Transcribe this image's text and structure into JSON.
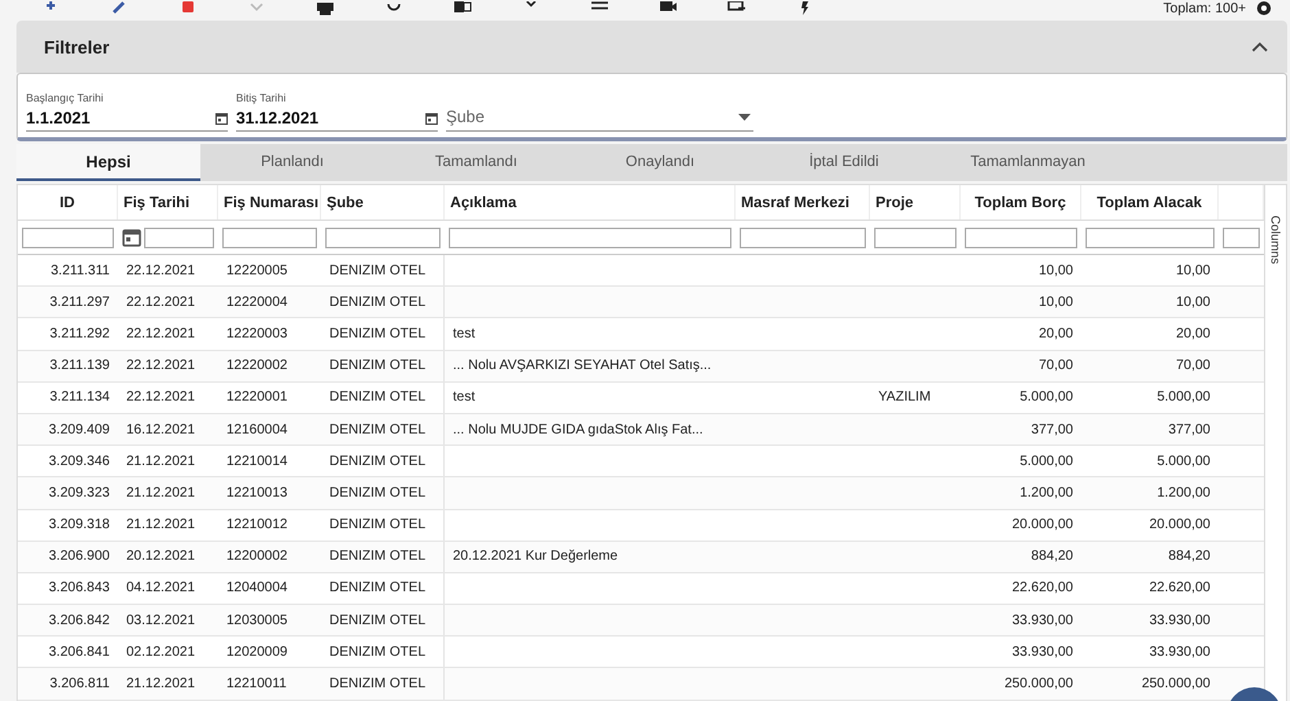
{
  "toolbar": {
    "total": "Toplam: 100+"
  },
  "filters": {
    "title": "Filtreler",
    "expanded": true,
    "start_date": {
      "label": "Başlangıç Tarihi",
      "value": "1.1.2021"
    },
    "end_date": {
      "label": "Bitiş Tarihi",
      "value": "31.12.2021"
    },
    "branch": {
      "placeholder": "Şube"
    }
  },
  "tabs": [
    {
      "label": "Hepsi",
      "selected": true
    },
    {
      "label": "Planlandı",
      "selected": false
    },
    {
      "label": "Tamamlandı",
      "selected": false
    },
    {
      "label": "Onaylandı",
      "selected": false
    },
    {
      "label": "İptal Edildi",
      "selected": false
    },
    {
      "label": "Tamamlanmayan",
      "selected": false
    }
  ],
  "table": {
    "columns": [
      {
        "label": "ID",
        "kind": "number"
      },
      {
        "label": "Fiş Tarihi",
        "kind": "date"
      },
      {
        "label": "Fiş Numarası",
        "kind": "text"
      },
      {
        "label": "Şube",
        "kind": "text"
      },
      {
        "label": "Açıklama",
        "kind": "text"
      },
      {
        "label": "Masraf Merkezi",
        "kind": "text"
      },
      {
        "label": "Proje",
        "kind": "text"
      },
      {
        "label": "Toplam Borç",
        "kind": "number"
      },
      {
        "label": "Toplam Alacak",
        "kind": "number"
      },
      {
        "kind": "text"
      }
    ],
    "rows": [
      [
        "3.211.311",
        "22.12.2021",
        "12220005",
        "DENIZIM OTEL",
        "",
        "",
        "",
        "10,00",
        "10,00"
      ],
      [
        "3.211.297",
        "22.12.2021",
        "12220004",
        "DENIZIM OTEL",
        "",
        "",
        "",
        "10,00",
        "10,00"
      ],
      [
        "3.211.292",
        "22.12.2021",
        "12220003",
        "DENIZIM OTEL",
        "test",
        "",
        "",
        "20,00",
        "20,00"
      ],
      [
        "3.211.139",
        "22.12.2021",
        "12220002",
        "DENIZIM OTEL",
        "... Nolu AVŞARKIZI SEYAHAT Otel Satış...",
        "",
        "",
        "70,00",
        "70,00"
      ],
      [
        "3.211.134",
        "22.12.2021",
        "12220001",
        "DENIZIM OTEL",
        "test",
        "",
        "YAZILIM",
        "5.000,00",
        "5.000,00"
      ],
      [
        "3.209.409",
        "16.12.2021",
        "12160004",
        "DENIZIM OTEL",
        "... Nolu MUJDE GIDA gıdaStok Alış Fat...",
        "",
        "",
        "377,00",
        "377,00"
      ],
      [
        "3.209.346",
        "21.12.2021",
        "12210014",
        "DENIZIM OTEL",
        "",
        "",
        "",
        "5.000,00",
        "5.000,00"
      ],
      [
        "3.209.323",
        "21.12.2021",
        "12210013",
        "DENIZIM OTEL",
        "",
        "",
        "",
        "1.200,00",
        "1.200,00"
      ],
      [
        "3.209.318",
        "21.12.2021",
        "12210012",
        "DENIZIM OTEL",
        "",
        "",
        "",
        "20.000,00",
        "20.000,00"
      ],
      [
        "3.206.900",
        "20.12.2021",
        "12200002",
        "DENIZIM OTEL",
        "20.12.2021 Kur Değerleme",
        "",
        "",
        "884,20",
        "884,20"
      ],
      [
        "3.206.843",
        "04.12.2021",
        "12040004",
        "DENIZIM OTEL",
        "",
        "",
        "",
        "22.620,00",
        "22.620,00"
      ],
      [
        "3.206.842",
        "03.12.2021",
        "12030005",
        "DENIZIM OTEL",
        "",
        "",
        "",
        "33.930,00",
        "33.930,00"
      ],
      [
        "3.206.841",
        "02.12.2021",
        "12020009",
        "DENIZIM OTEL",
        "",
        "",
        "",
        "33.930,00",
        "33.930,00"
      ],
      [
        "3.206.811",
        "21.12.2021",
        "12210011",
        "DENIZIM OTEL",
        "",
        "",
        "",
        "250.000,00",
        "250.000,00"
      ]
    ]
  },
  "side_panel": {
    "label": "Columns"
  }
}
